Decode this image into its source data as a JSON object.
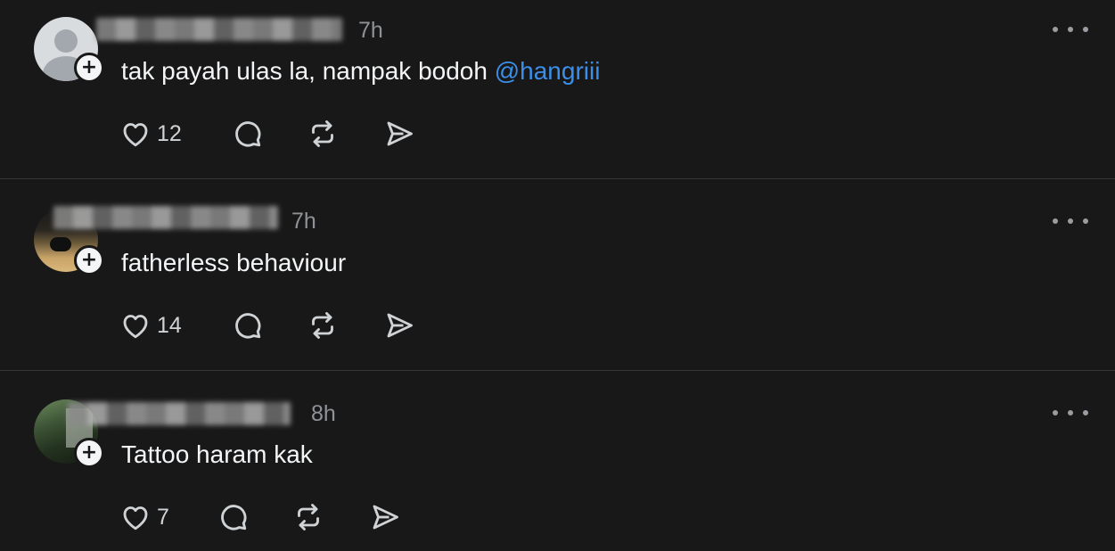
{
  "posts": [
    {
      "timestamp": "7h",
      "text": "tak payah ulas la, nampak bodoh ",
      "mention": "@hangriii",
      "likes": "12"
    },
    {
      "timestamp": "7h",
      "text": "fatherless behaviour",
      "likes": "14"
    },
    {
      "timestamp": "8h",
      "text": "Tattoo haram kak",
      "likes": "7"
    }
  ],
  "icons": {
    "like": "heart-icon",
    "comment": "comment-bubble-icon",
    "repost": "repost-icon",
    "share": "send-icon",
    "more": "more-horizontal-icon",
    "follow": "plus-icon"
  },
  "colors": {
    "background": "#181818",
    "text": "#f3f5f7",
    "muted": "#8f9296",
    "mention": "#3b8fe8",
    "divider": "#333638"
  },
  "badge_symbol": "+"
}
